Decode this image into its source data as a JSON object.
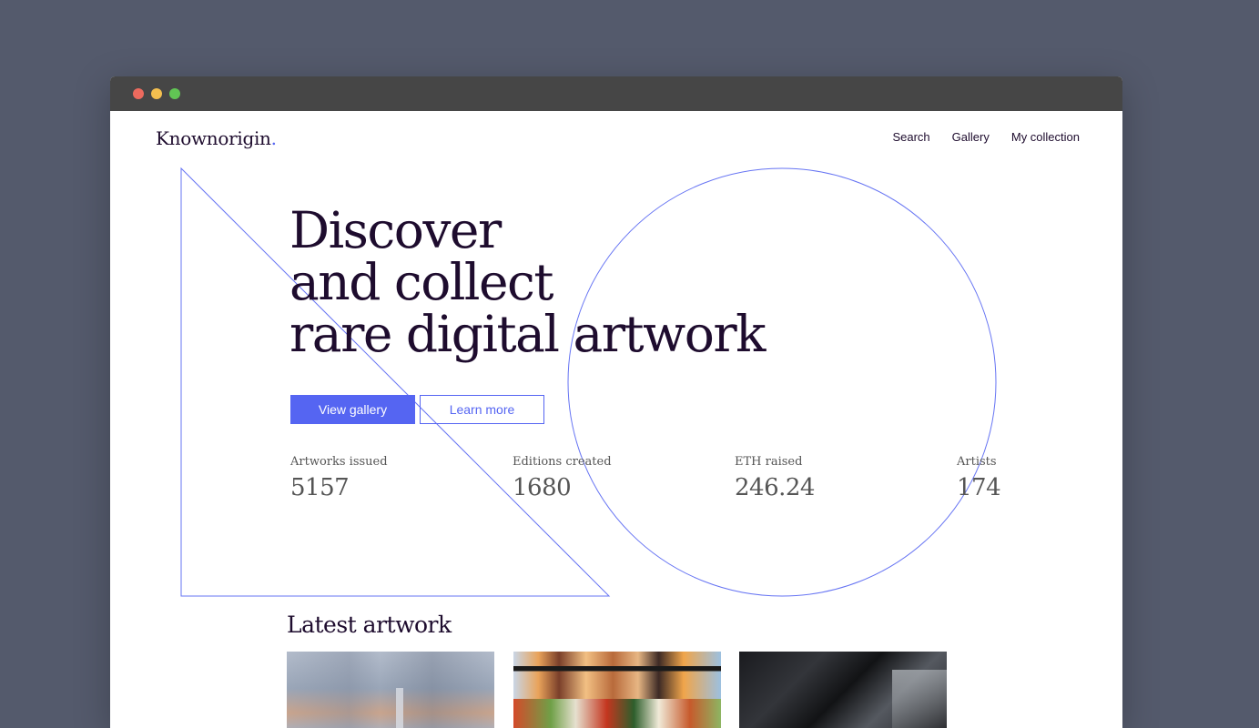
{
  "window": {
    "controls": [
      "close",
      "minimize",
      "maximize"
    ]
  },
  "header": {
    "brand": "Knownorigin",
    "brand_suffix": ".",
    "nav": [
      "Search",
      "Gallery",
      "My collection"
    ]
  },
  "hero": {
    "lines": [
      "Discover",
      "and collect",
      "rare digital artwork"
    ],
    "primary_button": "View gallery",
    "secondary_button": "Learn more"
  },
  "stats": [
    {
      "label": "Artworks issued",
      "value": "5157"
    },
    {
      "label": "Editions created",
      "value": "1680"
    },
    {
      "label": "ETH raised",
      "value": "246.24"
    },
    {
      "label": "Artists",
      "value": "174"
    }
  ],
  "latest": {
    "title": "Latest artwork"
  },
  "colors": {
    "accent": "#5565f2",
    "text": "#1e0c2e",
    "muted": "#555555",
    "backdrop": "#545a6c",
    "title_bar": "#464646"
  },
  "icons": [
    "close-dot-icon",
    "minimize-dot-icon",
    "maximize-dot-icon"
  ]
}
